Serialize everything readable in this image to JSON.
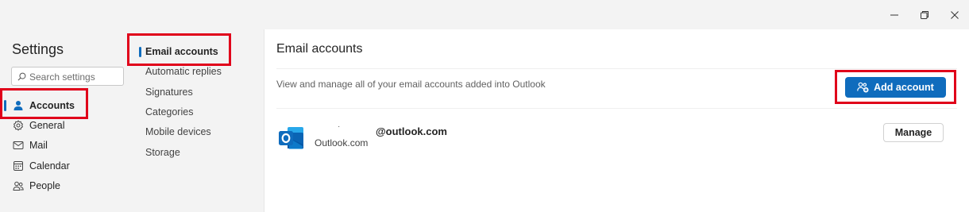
{
  "window": {
    "minimize_icon": "minimize-icon",
    "restore_icon": "restore-icon",
    "close_icon": "close-icon"
  },
  "nav": {
    "title": "Settings",
    "search_placeholder": "Search settings",
    "items": [
      {
        "label": "Accounts",
        "icon": "person-icon",
        "selected": true
      },
      {
        "label": "General",
        "icon": "gear-icon"
      },
      {
        "label": "Mail",
        "icon": "mail-icon"
      },
      {
        "label": "Calendar",
        "icon": "calendar-icon"
      },
      {
        "label": "People",
        "icon": "people-icon"
      }
    ]
  },
  "subnav": {
    "items": [
      {
        "label": "Email accounts",
        "selected": true
      },
      {
        "label": "Automatic replies"
      },
      {
        "label": "Signatures"
      },
      {
        "label": "Categories"
      },
      {
        "label": "Mobile devices"
      },
      {
        "label": "Storage"
      }
    ]
  },
  "content": {
    "title": "Email accounts",
    "description": "View and manage all of your email accounts added into Outlook",
    "add_account_label": "Add account",
    "account": {
      "dot": "·",
      "email": "@outlook.com",
      "provider": "Outlook.com",
      "manage_label": "Manage"
    }
  },
  "colors": {
    "accent": "#0f6cbd",
    "highlight": "#e0001a",
    "outlook_blue": "#0a64b4"
  }
}
